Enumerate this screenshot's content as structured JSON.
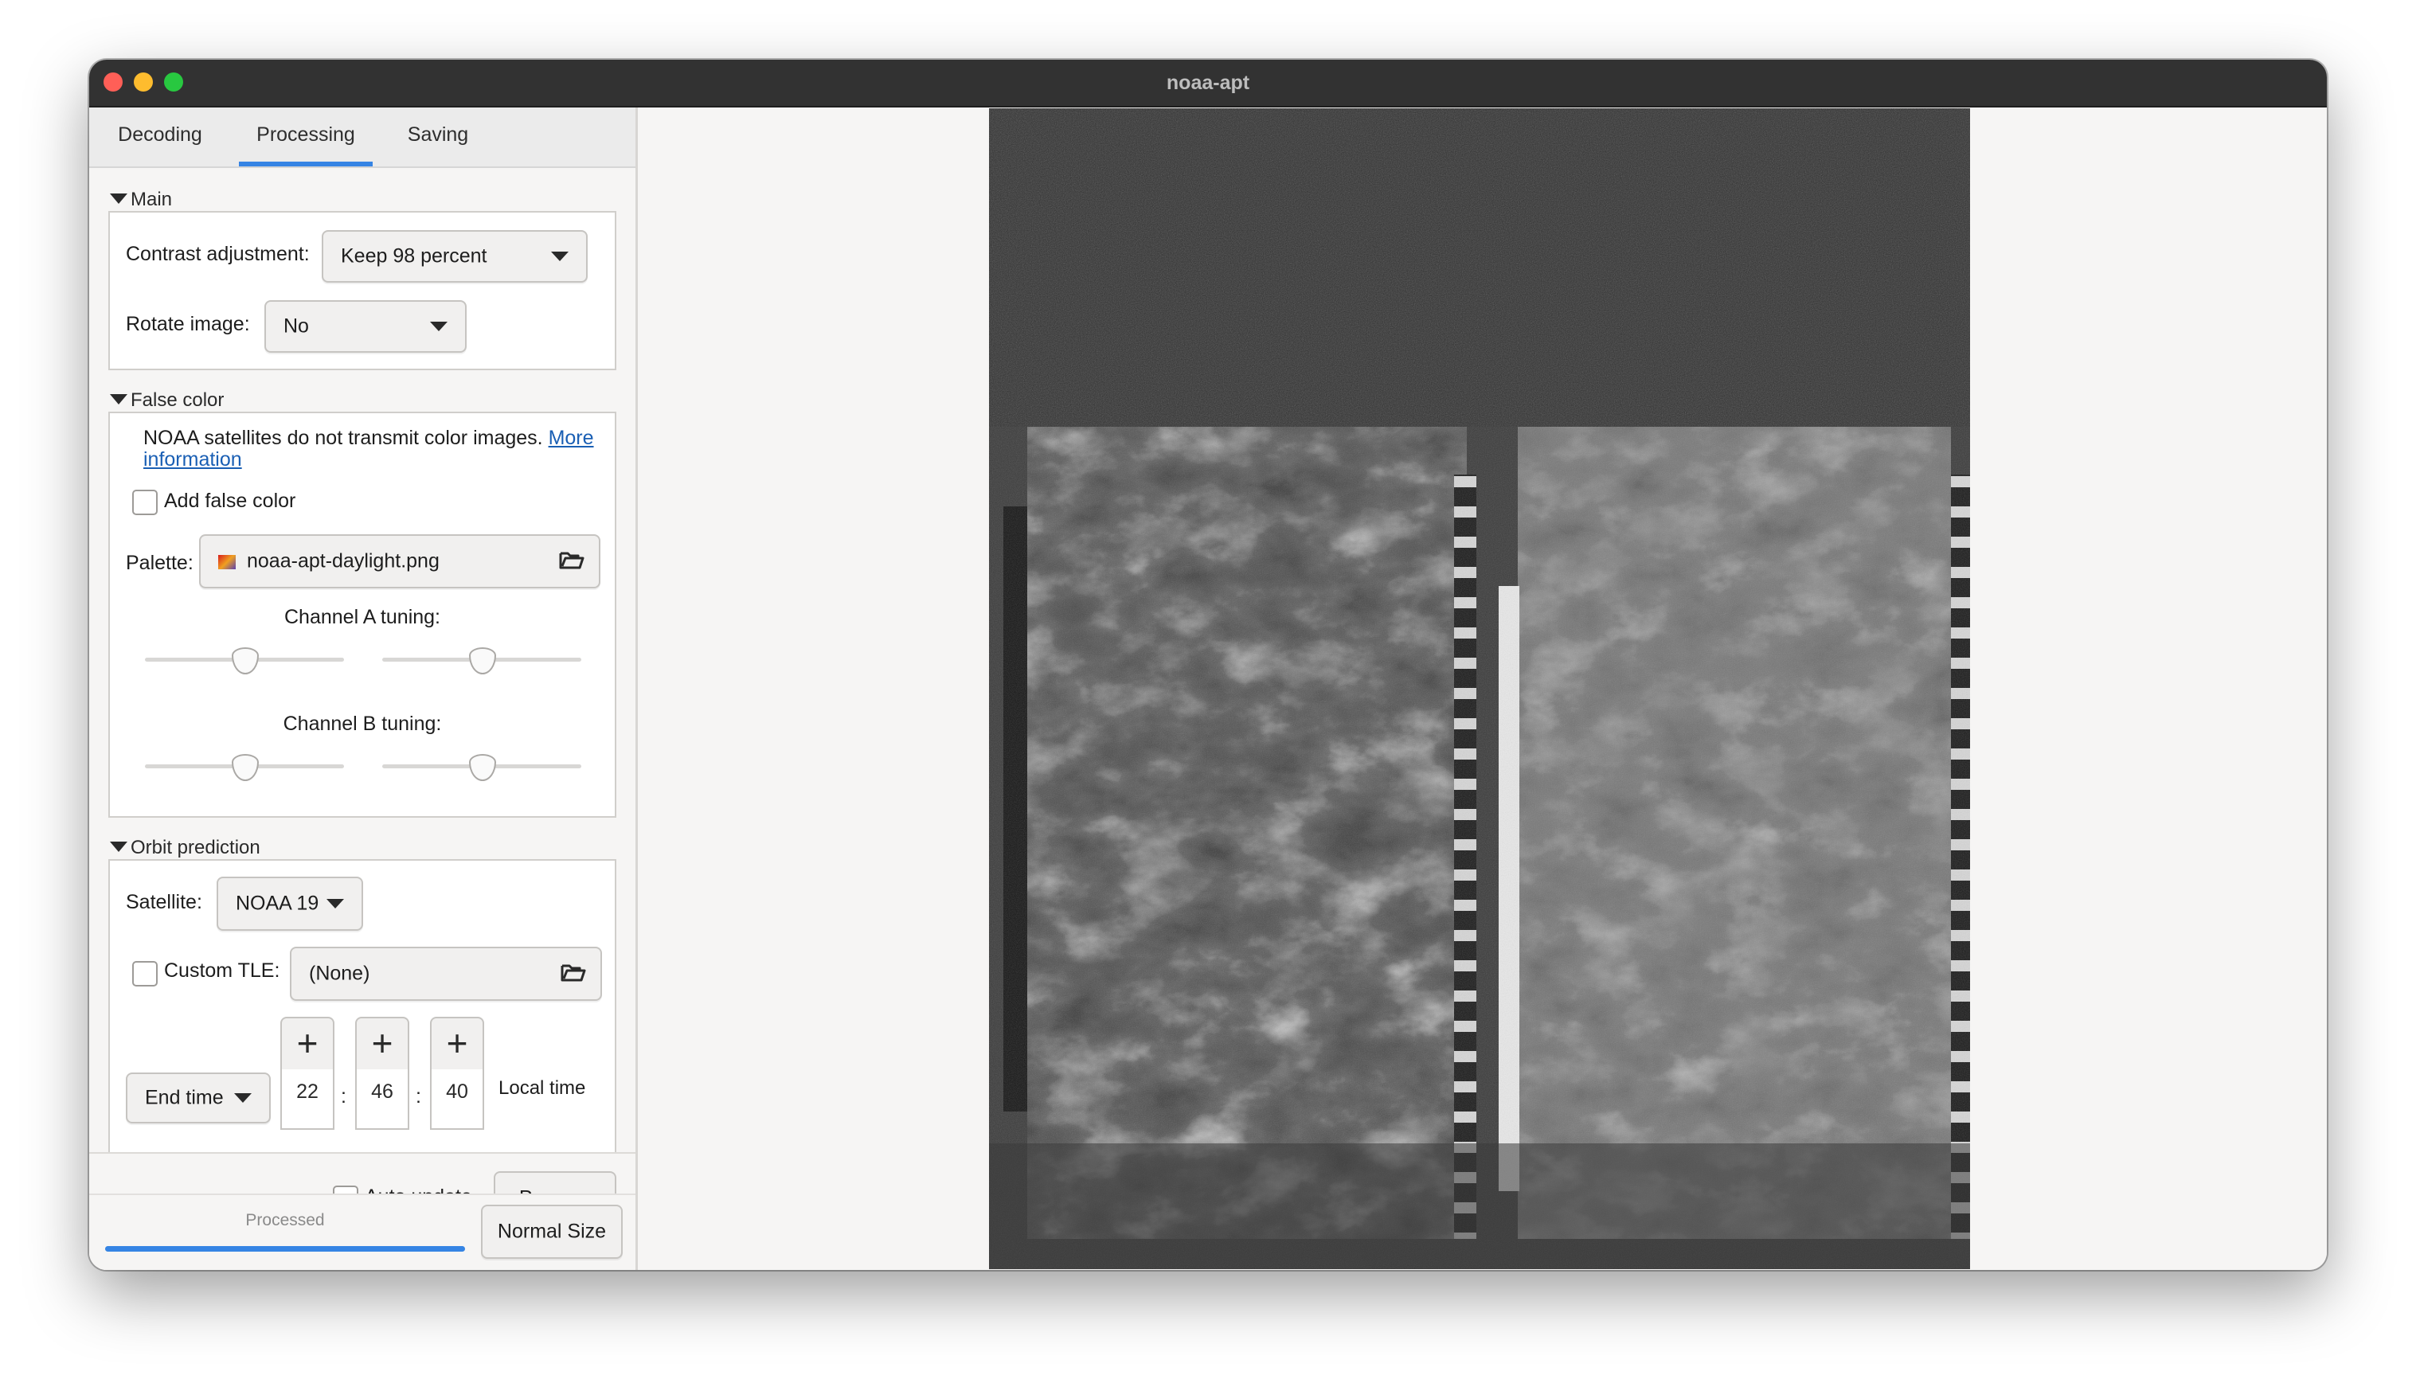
{
  "window": {
    "title": "noaa-apt"
  },
  "tabs": [
    {
      "label": "Decoding",
      "active": false
    },
    {
      "label": "Processing",
      "active": true
    },
    {
      "label": "Saving",
      "active": false
    }
  ],
  "main": {
    "header": "Main",
    "contrast_label": "Contrast adjustment:",
    "contrast_value": "Keep 98 percent",
    "rotate_label": "Rotate image:",
    "rotate_value": "No"
  },
  "false_color": {
    "header": "False color",
    "notice": "NOAA satellites do not transmit color images.",
    "more_link_1": "More",
    "more_link_2": "information",
    "add_label": "Add false color",
    "add_checked": false,
    "palette_label": "Palette:",
    "palette_value": "noaa-apt-daylight.png",
    "channel_a_label": "Channel A tuning:",
    "channel_b_label": "Channel B tuning:",
    "channel_a_values": [
      0.5,
      0.5
    ],
    "channel_b_values": [
      0.5,
      0.5
    ]
  },
  "orbit": {
    "header": "Orbit prediction",
    "satellite_label": "Satellite:",
    "satellite_value": "NOAA 19",
    "custom_tle_label": "Custom TLE:",
    "custom_tle_checked": false,
    "custom_tle_value": "(None)",
    "time_mode": "End time",
    "hour": "22",
    "minute": "46",
    "second": "40",
    "sep": ":",
    "timezone_label": "Local time"
  },
  "actions": {
    "auto_update_label": "Auto update",
    "auto_update_checked": false,
    "process_label": "Process"
  },
  "status": {
    "text": "Processed",
    "progress": 1.0,
    "normal_size_label": "Normal Size"
  },
  "colors": {
    "accent": "#3584e4",
    "link": "#1a5fb4",
    "titlebar": "#323232"
  },
  "icons": {
    "palette_icon": "gradient-swatch-icon",
    "folder_icon": "folder-open-icon",
    "plus_icon": "plus-icon"
  }
}
